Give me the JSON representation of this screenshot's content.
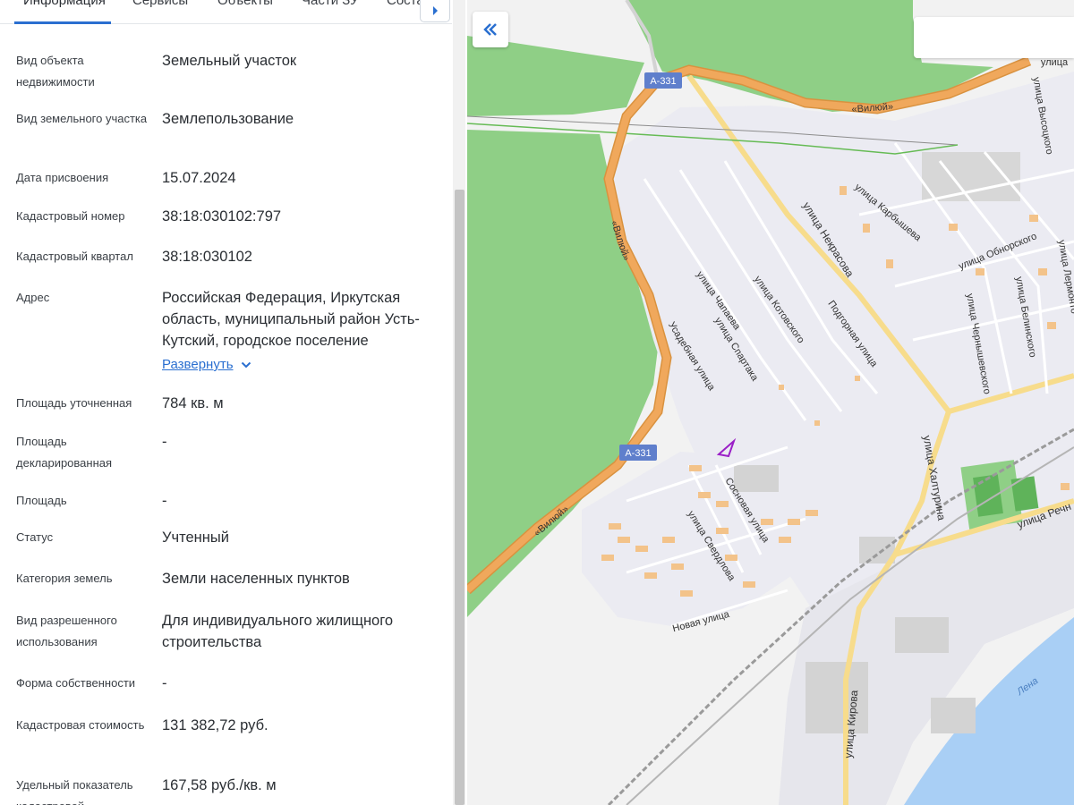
{
  "tabs": [
    {
      "label": "Информация",
      "active": true
    },
    {
      "label": "Сервисы"
    },
    {
      "label": "Объекты"
    },
    {
      "label": "Части ЗУ"
    },
    {
      "label": "Соста"
    }
  ],
  "fields": [
    {
      "label": "Вид объекта недвижимости",
      "value": "Земельный участок"
    },
    {
      "label": "Вид земельного участка",
      "value": "Землепользование"
    },
    {
      "label": "Дата присвоения",
      "value": "15.07.2024"
    },
    {
      "label": "Кадастровый номер",
      "value": "38:18:030102:797"
    },
    {
      "label": "Кадастровый квартал",
      "value": "38:18:030102"
    },
    {
      "label": "Адрес",
      "value": "Российская Федерация, Иркутская область, муниципальный район Усть-Кутский, городское поселение"
    },
    {
      "label": "Площадь уточненная",
      "value": "784 кв. м"
    },
    {
      "label": "Площадь декларированная",
      "value": "-"
    },
    {
      "label": "Площадь",
      "value": "-"
    },
    {
      "label": "Статус",
      "value": "Учтенный"
    },
    {
      "label": "Категория земель",
      "value": "Земли населенных пунктов"
    },
    {
      "label": "Вид разрешенного использования",
      "value": "Для индивидуального жилищного строительства"
    },
    {
      "label": "Форма собственности",
      "value": "-"
    },
    {
      "label": "Кадастровая стоимость",
      "value": "131 382,72 руб."
    },
    {
      "label": "Удельный показатель кадастровой",
      "value": "167,58 руб./кв. м"
    }
  ],
  "expand_label": "Развернуть",
  "map": {
    "search_placeholder": "",
    "labels": {
      "a331_1": "А-331",
      "a331_2": "А-331",
      "viluy_top": "«Вилюй»",
      "viluy_left": "«Вилюй»",
      "viluy_bottom": "«Вилюй»",
      "ulitsa_top": "улица",
      "vysotskogo": "улица Высоцкого",
      "karbysheva": "улица Карбышева",
      "nekrasova": "улица Некрасова",
      "obnorskogo": "улица Обнорского",
      "lermontova": "улица Лермонто",
      "chapaeva": "улица Чапаева",
      "kotovskogo": "улица Котовского",
      "podgornaya": "Подгорная улица",
      "belinskogo": "улица Белинского",
      "chernyshevskogo": "улица Чернышевского",
      "usadebnaya": "Усадебная улица",
      "spartaka": "улица Спартака",
      "khalturina": "улица Халтурина",
      "sosnovaya": "Сосновая улица",
      "sverdlova": "улица Свердлова",
      "rechnaya": "улица Речн",
      "novaya": "Новая улица",
      "kirova": "улица Кирова",
      "lena": "Лена"
    },
    "colors": {
      "forest": "#8fcf86",
      "land": "#f2f2f2",
      "residential": "#ebebf2",
      "major_road": "#f0a85c",
      "street": "#f7dc8c",
      "river": "#a9cff5",
      "building": "#d3d3d3",
      "house": "#f3c38a",
      "parcel": "#9a1fc7"
    }
  }
}
